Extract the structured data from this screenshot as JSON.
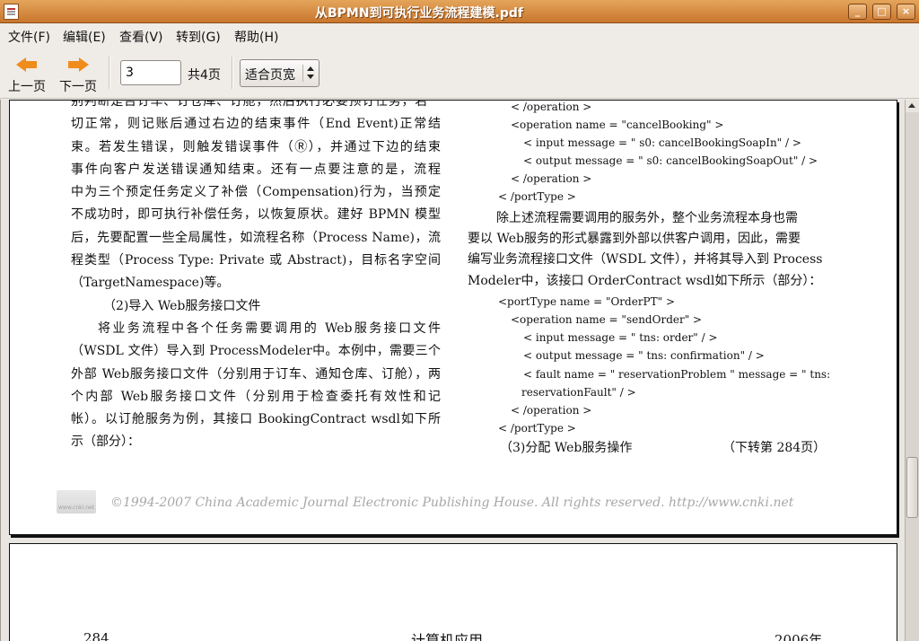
{
  "window": {
    "title": "从BPMN到可执行业务流程建模.pdf",
    "controls": {
      "minimize": "_",
      "maximize": "□",
      "close": "×"
    }
  },
  "menu": [
    {
      "label": "文件(F)"
    },
    {
      "label": "编辑(E)"
    },
    {
      "label": "查看(V)"
    },
    {
      "label": "转到(G)"
    },
    {
      "label": "帮助(H)"
    }
  ],
  "toolbar": {
    "prev_label": "上一页",
    "next_label": "下一页",
    "page_value": "3",
    "page_total": "共4页",
    "zoom_value": "适合页宽"
  },
  "document": {
    "left_column": [
      "别判断是否订车、订仓库、订舱，然后执行必要预订任务，若一",
      "切正常，则记账后通过右边的结束事件（End Event)正常结",
      "束。若发生错误，则触发错误事件（Ⓡ），并通过下边的结束",
      "事件向客户发送错误通知结束。还有一点要注意的是，流程",
      "中为三个预定任务定义了补偿（Compensation)行为，当预定",
      "不成功时，即可执行补偿任务，以恢复原状。建好 BPMN 模型",
      "后，先要配置一些全局属性，如流程名称（Process Name)，流",
      "程类型（Process Type: Private 或 Abstract)，目标名字空间",
      "（TargetNamespace)等。",
      "（2)导入 Web服务接口文件",
      "将业务流程中各个任务需要调用的 Web服务接口文件",
      "（WSDL 文件）导入到 ProcessModeler中。本例中，需要三个",
      "外部 Web服务接口文件（分别用于订车、通知仓库、订舱），两",
      "个内部 Web服务接口文件（分别用于检查委托有效性和记",
      "帐）。以订舱服务为例，其接口 BookingContract wsdl如下所",
      "示（部分）："
    ],
    "right_code_top": [
      "< /operation >",
      "<operation name = \"cancelBooking\" >",
      "< input message = \" s0: cancelBookingSoapIn\" / >",
      "< output message = \" s0: cancelBookingSoapOut\" / >",
      "< /operation >",
      "< /portType >"
    ],
    "right_text": [
      "除上述流程需要调用的服务外，整个业务流程本身也需",
      "要以 Web服务的形式暴露到外部以供客户调用，因此，需要",
      "编写业务流程接口文件（WSDL 文件），并将其导入到 Process",
      "Modeler中，该接口 OrderContract wsdl如下所示（部分）："
    ],
    "right_code_bottom": [
      "<portType name = \"OrderPT\" >",
      "<operation name = \"sendOrder\" >",
      "< input message = \" tns: order\" / >",
      "< output message = \" tns: confirmation\" / >",
      "< fault  name  =  \" reservationProblem \"  message  =  \" tns:",
      "reservationFault\" / >",
      "< /operation >",
      "< /portType >"
    ],
    "right_heading": "（3)分配 Web服务操作",
    "right_continue": "（下转第 284页）",
    "copyright": "©1994-2007 China Academic Journal Electronic Publishing House. All rights reserved.    http://www.cnki.net",
    "page2": {
      "left": "284",
      "center": "计算机应用",
      "right": "2006年"
    }
  }
}
